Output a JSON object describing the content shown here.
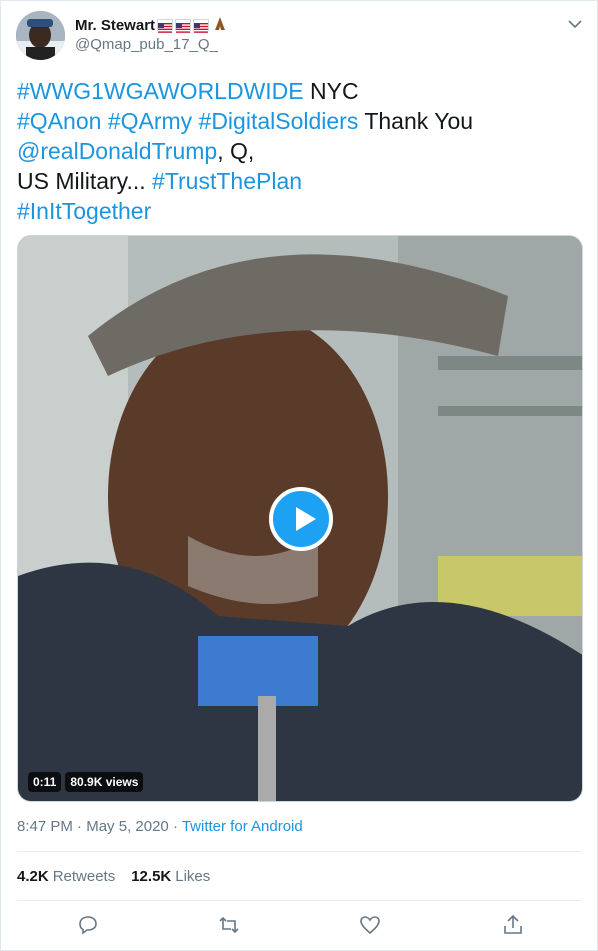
{
  "user": {
    "display_name": "Mr. Stewart",
    "name_emojis": [
      "us-flag-icon",
      "us-flag-icon",
      "us-flag-icon",
      "folded-hands-icon"
    ],
    "handle": "@Qmap_pub_17_Q_"
  },
  "tweet": {
    "lines": [
      [
        {
          "text": "#WWG1WGAWORLDWIDE",
          "link": true
        },
        {
          "text": " NYC",
          "link": false
        }
      ],
      [
        {
          "text": "#QAnon",
          "link": true
        },
        {
          "text": " ",
          "link": false
        },
        {
          "text": "#QArmy",
          "link": true
        },
        {
          "text": " ",
          "link": false
        },
        {
          "text": "#DigitalSoldiers",
          "link": true
        },
        {
          "text": " Thank You",
          "link": false
        }
      ],
      [
        {
          "text": "@realDonaldTrump",
          "link": true
        },
        {
          "text": ", Q,",
          "link": false
        }
      ],
      [
        {
          "text": "US Military... ",
          "link": false
        },
        {
          "text": "#TrustThePlan",
          "link": true
        }
      ],
      [
        {
          "text": "#InItTogether",
          "link": true
        }
      ]
    ]
  },
  "video": {
    "duration": "0:11",
    "views": "80.9K views"
  },
  "meta": {
    "time": "8:47 PM",
    "separator": " · ",
    "date": "May 5, 2020",
    "source": "Twitter for Android"
  },
  "stats": {
    "retweets_count": "4.2K",
    "retweets_label": "Retweets",
    "likes_count": "12.5K",
    "likes_label": "Likes"
  },
  "actions": [
    "reply-icon",
    "retweet-icon",
    "like-icon",
    "share-icon"
  ],
  "colors": {
    "link": "#1b95e0",
    "secondary": "#657786",
    "primary": "#14171a",
    "play_button": "#1da1f2"
  }
}
